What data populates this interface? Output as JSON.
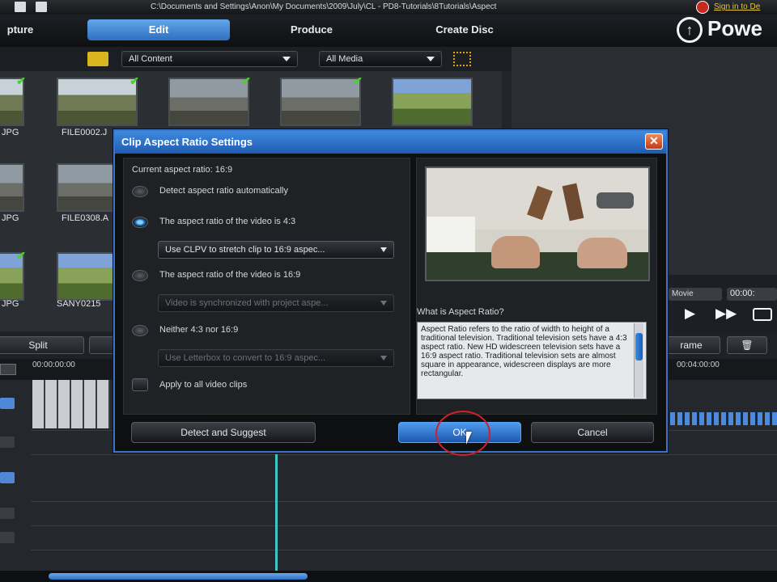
{
  "window": {
    "path": "C:\\Documents and Settings\\Anon\\My Documents\\2009\\July\\CL - PD8-Tutorials\\8Tutorials\\Aspect",
    "signin": "Sign in to De"
  },
  "tabs": [
    {
      "label": "pture"
    },
    {
      "label": "Edit"
    },
    {
      "label": "Produce"
    },
    {
      "label": "Create Disc"
    }
  ],
  "brand": {
    "name": "Powe"
  },
  "library": {
    "content_filter": "All Content",
    "media_filter": "All Media",
    "thumb_labels": [
      "JPG",
      "FILE0002.J",
      "JPG",
      "FILE0308.A",
      "JPG",
      "SANY0215"
    ]
  },
  "preview": {
    "movie_label": "Movie",
    "time": "00:00:"
  },
  "edit_toolbar": {
    "split": "Split",
    "frame": "rame"
  },
  "ruler": {
    "t0": "00:00:00:00",
    "t1": "00:04:00:00"
  },
  "dialog": {
    "title": "Clip Aspect Ratio Settings",
    "current": "Current aspect ratio: 16:9",
    "opt_detect": "Detect aspect ratio automatically",
    "opt_43": "The aspect ratio of the video is 4:3",
    "sel_43": "Use CLPV to stretch clip to 16:9 aspec...",
    "opt_169": "The aspect ratio of the video is 16:9",
    "sel_169": "Video is synchronized with project aspe...",
    "opt_neither": "Neither 4:3 nor 16:9",
    "sel_neither": "Use Letterbox to convert to 16:9 aspec...",
    "apply_all": "Apply to all video clips",
    "what_title": "What is Aspect Ratio?",
    "what_text": "Aspect Ratio refers to the ratio of width to height of a traditional television. Traditional television sets have a 4:3 aspect ratio. New HD widescreen television sets have a 16:9 aspect ratio. Traditional television sets are almost square in appearance, widescreen displays are more rectangular.",
    "btn_detect": "Detect and Suggest",
    "btn_ok": "OK",
    "btn_cancel": "Cancel"
  }
}
